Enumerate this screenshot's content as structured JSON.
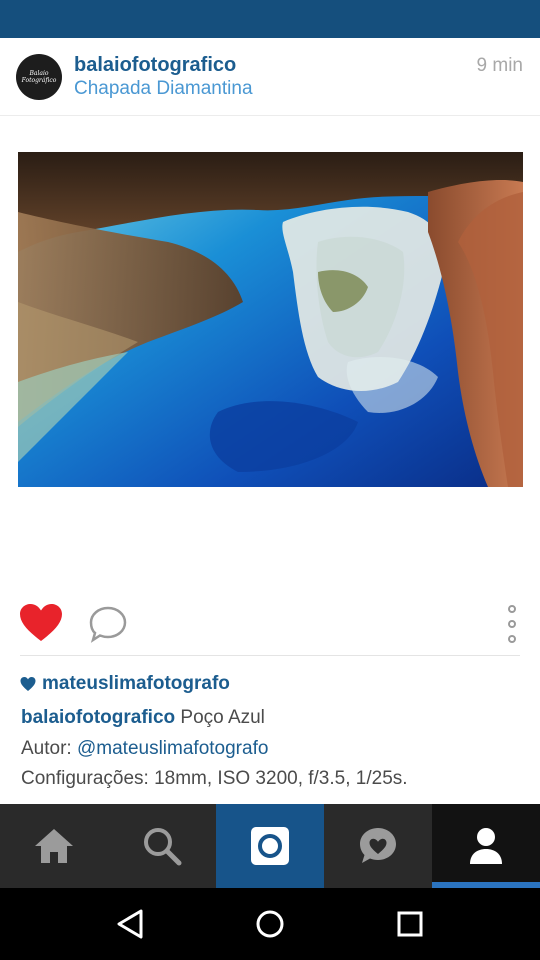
{
  "post": {
    "username": "balaiofotografico",
    "location": "Chapada Diamantina",
    "time_ago": "9 min",
    "avatar_text": "Balaio Fotográfico",
    "liked_by": "mateuslimafotografo",
    "caption_user": "balaiofotografico",
    "caption_text": " Poço Azul",
    "author_label": "Autor: ",
    "author_mention": "@mateuslimafotografo",
    "settings_line": "Configurações: 18mm, ISO 3200, f/3.5, 1/25s."
  },
  "colors": {
    "brand_blue": "#154f7d",
    "link_blue": "#1c5d8f",
    "location_blue": "#4a98d3",
    "like_red": "#e8232b",
    "tab_active": "#17548a"
  },
  "icons": {
    "like": "heart-icon",
    "comment": "speech-bubble-icon",
    "more": "vertical-dots-icon",
    "home": "home-icon",
    "search": "search-icon",
    "camera": "camera-icon",
    "activity": "heart-bubble-icon",
    "profile": "person-icon",
    "back": "back-triangle-icon",
    "system_home": "circle-home-icon",
    "recents": "square-recents-icon"
  }
}
